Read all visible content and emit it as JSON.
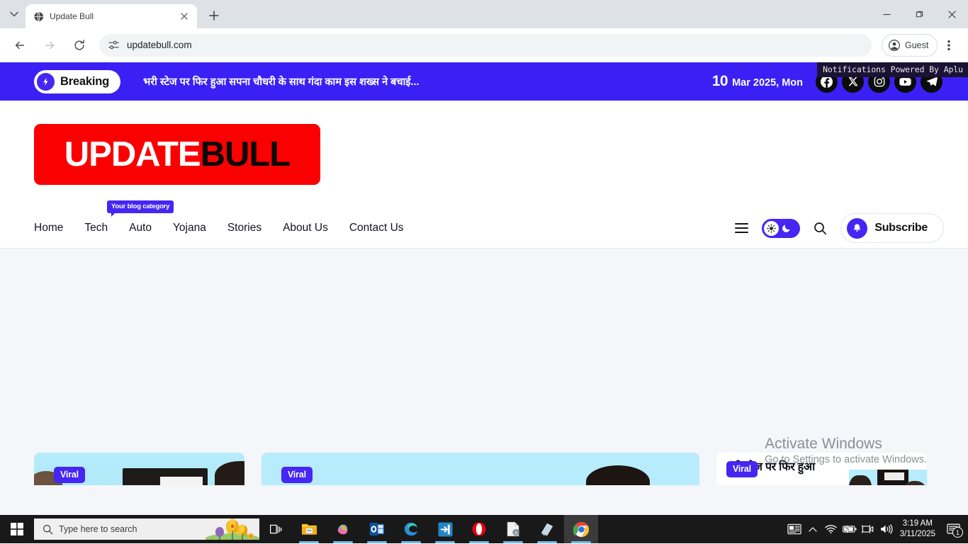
{
  "browser": {
    "tab": {
      "title": "Update Bull",
      "favicon": "globe-icon",
      "close": "×"
    },
    "newtab_label": "+",
    "window": {
      "minimize": "—",
      "maximize": "▢",
      "close": "✕"
    },
    "toolbar": {
      "back": "back-icon",
      "forward": "forward-icon",
      "reload": "reload-icon",
      "site_info": "tune-icon",
      "url": "updatebull.com",
      "profile_label": "Guest",
      "menu": "three-dot-icon"
    }
  },
  "site": {
    "breaking": {
      "badge_label": "Breaking",
      "headline": "भरी स्टेज पर फिर हुआ सपना चौधरी के साथ गंदा काम इस शख्स ने बचाई...",
      "date_day": "10",
      "date_rest": "Mar 2025, Mon",
      "socials": [
        "facebook-icon",
        "x-icon",
        "instagram-icon",
        "youtube-icon",
        "telegram-icon"
      ],
      "notification_overlay": "Notifications Powered By Aplu",
      "bg_color": "#3a20f5"
    },
    "logo": {
      "part1": "UPDATE",
      "part2": "BULL",
      "bg_color": "#fb0000"
    },
    "nav": {
      "links": [
        "Home",
        "Tech",
        "Auto",
        "Yojana",
        "Stories",
        "About Us",
        "Contact Us"
      ],
      "tooltip": "Your blog category",
      "hamburger": "menu-icon",
      "mode_toggle": {
        "sun": "sun-icon",
        "moon": "moon-icon"
      },
      "search": "search-icon",
      "subscribe": {
        "label": "Subscribe",
        "icon": "bell-icon"
      },
      "accent_color": "#4526f2"
    },
    "cards": [
      {
        "badge": "Viral",
        "title": ""
      },
      {
        "badge": "Viral",
        "title": ""
      },
      {
        "badge": "Viral",
        "title": "भरी स्टेज पर फिर हुआ"
      }
    ],
    "watermark": {
      "title": "Activate Windows",
      "subtitle": "Go to Settings to activate Windows."
    }
  },
  "taskbar": {
    "start": "windows-icon",
    "search_placeholder": "Type here to search",
    "task_view": "task-view-icon",
    "apps": [
      "file-explorer-icon",
      "copilot-icon",
      "outlook-icon",
      "edge-icon",
      "app-blue-icon",
      "opera-icon",
      "pdf-icon",
      "sticky-notes-icon",
      "chrome-icon"
    ],
    "tray": {
      "news": "news-icon",
      "chevron": "chevron-up-icon",
      "wifi": "wifi-icon",
      "battery": "battery-icon",
      "camera": "camera-icon",
      "volume": "volume-icon",
      "time": "3:19 AM",
      "date": "3/11/2025",
      "notification_count": "1"
    }
  }
}
